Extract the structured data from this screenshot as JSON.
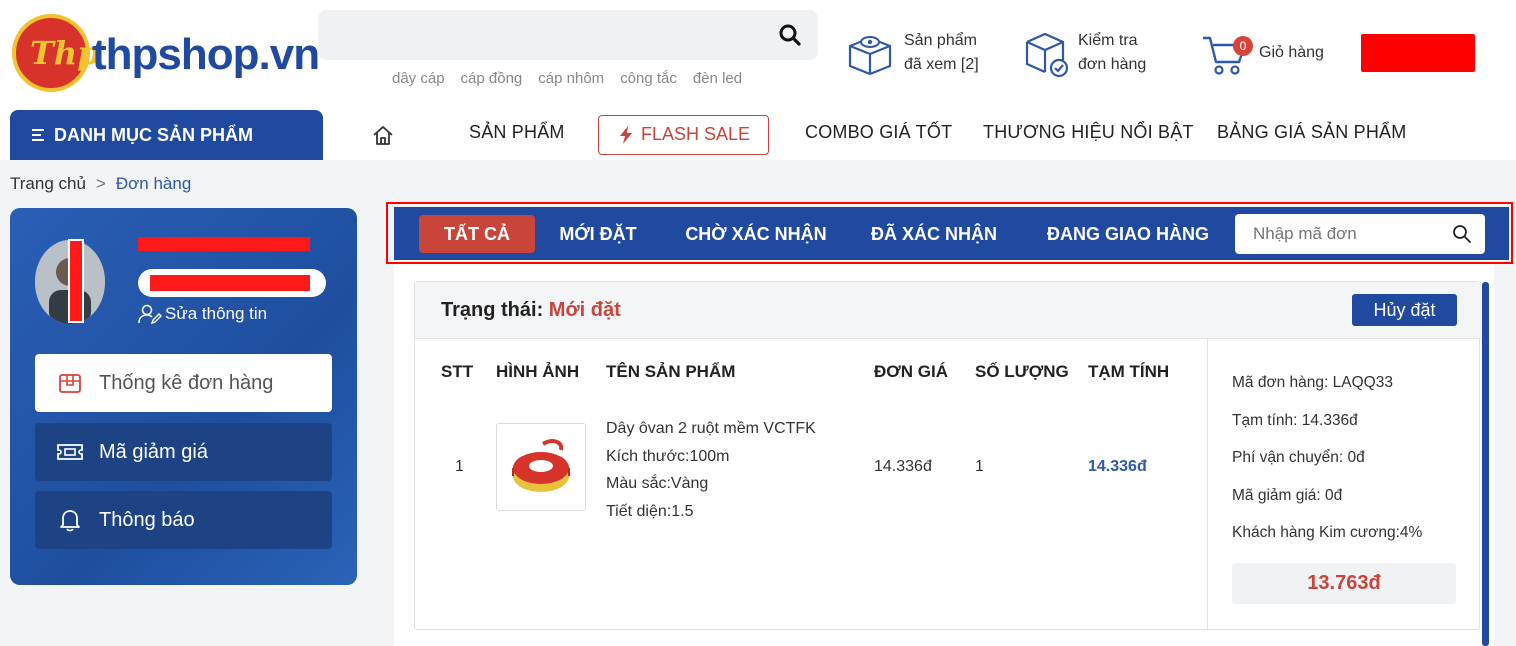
{
  "header": {
    "logo_text": "thpshop.vn",
    "logo_mark": "Thp",
    "search_tags": [
      "dây cáp",
      "cáp đồng",
      "cáp nhôm",
      "công tắc",
      "đèn led"
    ],
    "viewed": {
      "line1": "Sản phẩm",
      "line2": "đã xem [2]"
    },
    "check": {
      "line1": "Kiểm tra",
      "line2": "đơn hàng"
    },
    "cart": {
      "label": "Giỏ hàng",
      "count": "0"
    }
  },
  "nav": {
    "category_button": "DANH MỤC SẢN PHẨM",
    "items": [
      "SẢN PHẨM",
      "FLASH SALE",
      "COMBO GIÁ TỐT",
      "THƯƠNG HIỆU NỔI BẬT",
      "BẢNG GIÁ SẢN PHẨM"
    ]
  },
  "breadcrumb": {
    "home": "Trang chủ",
    "separator": ">",
    "current": "Đơn hàng"
  },
  "sidebar": {
    "edit_info": "Sửa thông tin",
    "menu": [
      "Thống kê đơn hàng",
      "Mã giảm giá",
      "Thông báo"
    ]
  },
  "tabs": {
    "items": [
      "TẤT CẢ",
      "MỚI ĐẶT",
      "CHỜ XÁC NHẬN",
      "ĐÃ XÁC NHẬN",
      "ĐANG GIAO HÀNG"
    ],
    "active_index": 0,
    "search_placeholder": "Nhập mã đơn"
  },
  "order": {
    "status_label": "Trạng thái:",
    "status_value": "Mới đặt",
    "cancel_button": "Hủy đặt",
    "columns": [
      "STT",
      "HÌNH ẢNH",
      "TÊN SẢN PHẨM",
      "ĐƠN GIÁ",
      "SỐ LƯỢNG",
      "TẠM TÍNH"
    ],
    "row": {
      "index": "1",
      "name": "Dây ôvan 2 ruột mềm VCTFK",
      "size": "Kích thước:100m",
      "color": "Màu sắc:Vàng",
      "section": "Tiết diện:1.5",
      "unit_price": "14.336đ",
      "quantity": "1",
      "subtotal": "14.336đ"
    },
    "summary": {
      "code": "Mã đơn hàng: LAQQ33",
      "subtotal": "Tạm tính: 14.336đ",
      "shipping": "Phí vận chuyển: 0đ",
      "discount": "Mã giảm giá: 0đ",
      "tier": "Khách hàng Kim cương:4%",
      "total": "13.763đ"
    }
  },
  "colors": {
    "brand_blue": "#1f4aa0",
    "accent_red": "#c9443a",
    "redaction": "#ff0000"
  }
}
